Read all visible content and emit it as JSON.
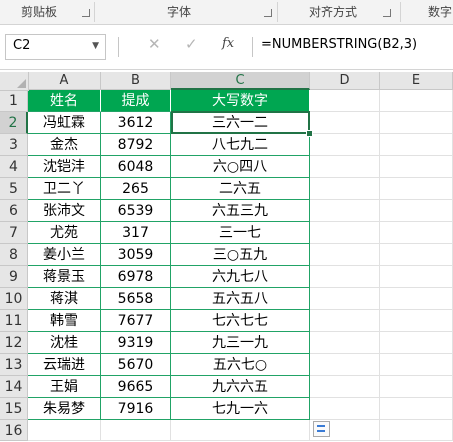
{
  "ribbon": {
    "groups": [
      "剪贴板",
      "字体",
      "对齐方式",
      "数字"
    ]
  },
  "formula_bar": {
    "name_box": "C2",
    "formula": "=NUMBERSTRING(B2,3)",
    "cancel_symbol": "✕",
    "enter_symbol": "✓",
    "fx_label": "fx"
  },
  "columns": [
    "A",
    "B",
    "C",
    "D",
    "E"
  ],
  "rows": [
    "1",
    "2",
    "3",
    "4",
    "5",
    "6",
    "7",
    "8",
    "9",
    "10",
    "11",
    "12",
    "13",
    "14",
    "15",
    "16"
  ],
  "table": {
    "headers": [
      "姓名",
      "提成",
      "大写数字"
    ],
    "rows": [
      [
        "冯虹霖",
        "3612",
        "三六一二"
      ],
      [
        "金杰",
        "8792",
        "八七九二"
      ],
      [
        "沈铠沣",
        "6048",
        "六○四八"
      ],
      [
        "卫二丫",
        "265",
        "二六五"
      ],
      [
        "张沛文",
        "6539",
        "六五三九"
      ],
      [
        "尤苑",
        "317",
        "三一七"
      ],
      [
        "姜小兰",
        "3059",
        "三○五九"
      ],
      [
        "蒋景玉",
        "6978",
        "六九七八"
      ],
      [
        "蒋淇",
        "5658",
        "五六五八"
      ],
      [
        "韩雪",
        "7677",
        "七六七七"
      ],
      [
        "沈桂",
        "9319",
        "九三一九"
      ],
      [
        "云瑞进",
        "5670",
        "五六七○"
      ],
      [
        "王娟",
        "9665",
        "九六六五"
      ],
      [
        "朱易梦",
        "7916",
        "七九一六"
      ]
    ]
  },
  "colors": {
    "table_header_bg": "#00a651",
    "accent": "#217346"
  },
  "icons": {
    "quick_analysis": "quick-analysis-icon"
  }
}
